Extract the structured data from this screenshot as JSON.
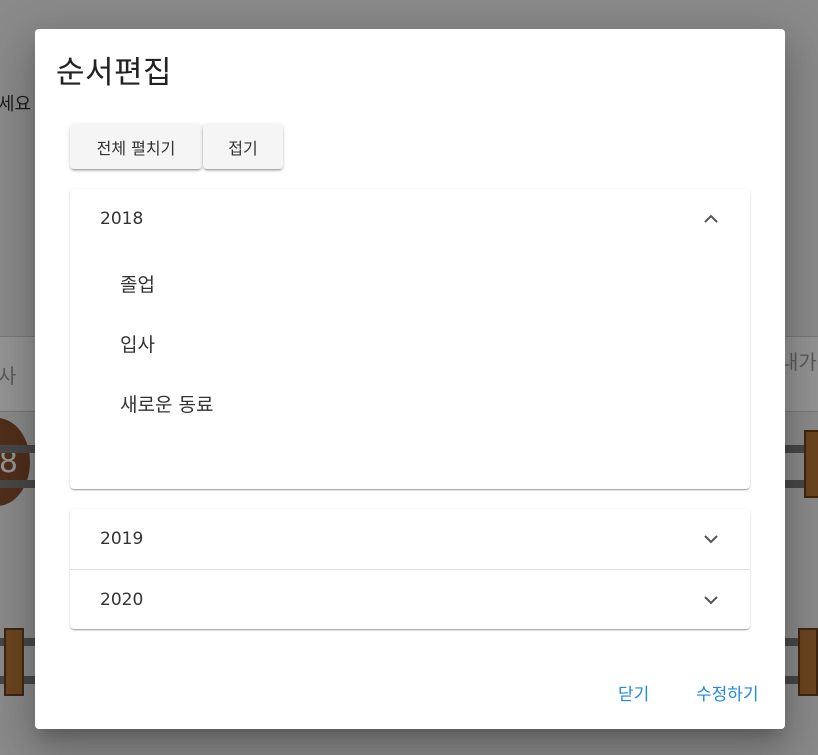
{
  "background": {
    "left_text": "세요",
    "bar_left_text": "사",
    "bar_right_text": "내가",
    "circle_text": "8"
  },
  "dialog": {
    "title": "순서편집",
    "expand_all_label": "전체 펼치기",
    "collapse_label": "접기",
    "panels": [
      {
        "year": "2018",
        "expanded": true,
        "items": [
          "졸업",
          "입사",
          "새로운 동료"
        ]
      },
      {
        "year": "2019",
        "expanded": false
      },
      {
        "year": "2020",
        "expanded": false
      }
    ],
    "actions": {
      "close_label": "닫기",
      "save_label": "수정하기"
    },
    "colors": {
      "accent": "#1e88e5"
    }
  }
}
